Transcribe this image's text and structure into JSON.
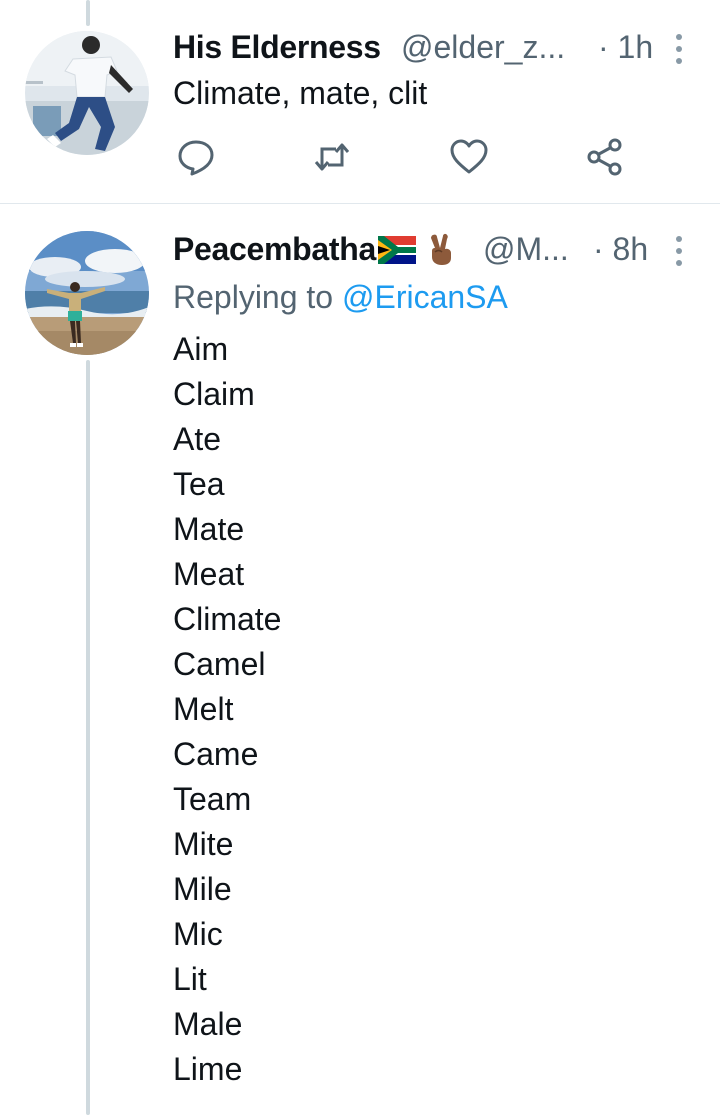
{
  "tweet1": {
    "display_name": "His Elderness",
    "handle": "@elder_z...",
    "time": "· 1h",
    "text": "Climate, mate, clit",
    "actions": [
      "reply-icon",
      "retweet-icon",
      "like-icon",
      "share-icon"
    ]
  },
  "tweet2": {
    "display_name": "Peacembatha",
    "name_emojis": [
      "south-africa-flag-icon",
      "victory-hand-icon"
    ],
    "handle": "@M...",
    "time": "· 8h",
    "replying_prefix": "Replying to",
    "replying_mention": "@EricanSA",
    "lines": [
      "Aim",
      "Claim",
      "Ate",
      "Tea",
      "Mate",
      "Meat",
      "Climate",
      "Camel",
      "Melt",
      "Came",
      "Team",
      "Mite",
      "Mile",
      "Mic",
      "Lit",
      "Male",
      "Lime"
    ]
  },
  "colors": {
    "text": "#0f1419",
    "secondary": "#536471",
    "link": "#1d9bf0",
    "thread_line": "#cfd9de"
  }
}
